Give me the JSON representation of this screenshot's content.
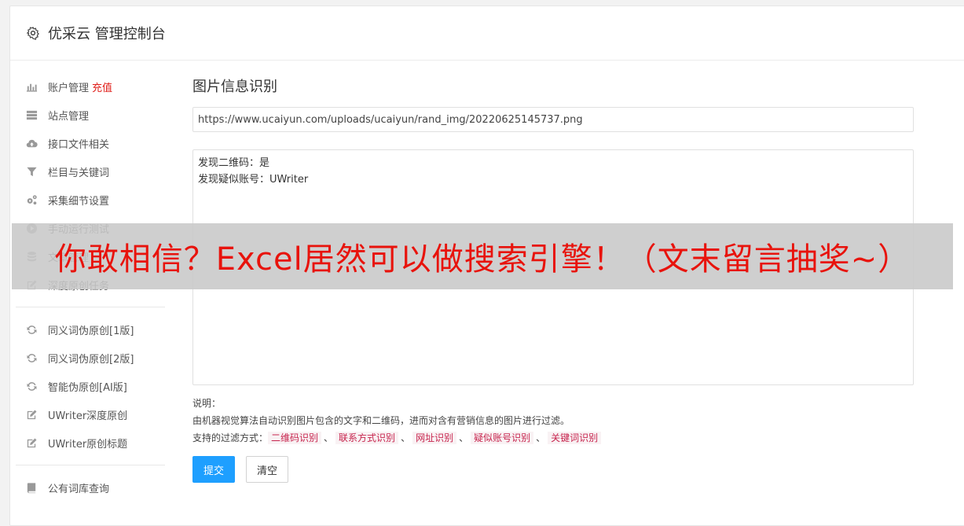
{
  "header": {
    "title": "优采云 管理控制台"
  },
  "sidebar": {
    "recharge": "充值",
    "group1": [
      {
        "label": "账户管理",
        "icon": "bar-chart-icon"
      },
      {
        "label": "站点管理",
        "icon": "server-icon"
      },
      {
        "label": "接口文件相关",
        "icon": "cloud-upload-icon"
      },
      {
        "label": "栏目与关键词",
        "icon": "filter-icon"
      },
      {
        "label": "采集细节设置",
        "icon": "gears-icon"
      },
      {
        "label": "手动运行测试",
        "icon": "play-circle-icon"
      },
      {
        "label": "文章管理",
        "icon": "database-icon"
      },
      {
        "label": "深度原创任务",
        "icon": "edit-icon"
      }
    ],
    "group2": [
      {
        "label": "同义词伪原创[1版]",
        "icon": "refresh-icon"
      },
      {
        "label": "同义词伪原创[2版]",
        "icon": "refresh-icon"
      },
      {
        "label": "智能伪原创[AI版]",
        "icon": "refresh-icon"
      },
      {
        "label": "UWriter深度原创",
        "icon": "edit-icon"
      },
      {
        "label": "UWriter原创标题",
        "icon": "edit-icon"
      }
    ],
    "group3": [
      {
        "label": "公有词库查询",
        "icon": "book-icon"
      }
    ]
  },
  "main": {
    "section_title": "图片信息识别",
    "url_value": "https://www.ucaiyun.com/uploads/ucaiyun/rand_img/20220625145737.png",
    "result_lines": [
      "发现二维码：是",
      "发现疑似账号：UWriter"
    ],
    "notes_label": "说明：",
    "notes_desc": "由机器视觉算法自动识别图片包含的文字和二维码，进而对含有营销信息的图片进行过滤。",
    "filter_label": "支持的过滤方式：",
    "filter_tags": [
      "二维码识别",
      "联系方式识别",
      "网址识别",
      "疑似账号识别",
      "关键词识别"
    ],
    "tag_sep": "、",
    "submit_label": "提交",
    "clear_label": "清空"
  },
  "overlay": {
    "text": "你敢相信？Excel居然可以做搜索引擎！（文末留言抽奖~）"
  }
}
